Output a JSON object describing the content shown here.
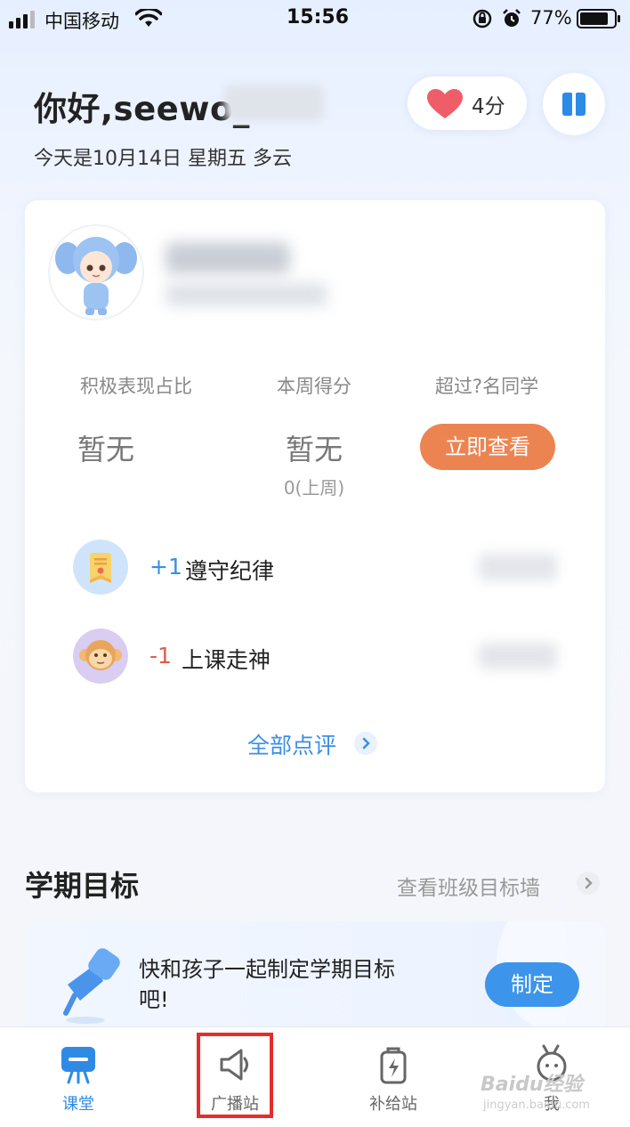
{
  "status_bar": {
    "carrier": "中国移动",
    "time": "15:56",
    "battery": "77%"
  },
  "header": {
    "greeting": "你好,seewo_",
    "date_line": "今天是10月14日 星期五 多云",
    "score": "4分"
  },
  "performance": {
    "stats": [
      {
        "label": "积极表现占比",
        "value": "暂无"
      },
      {
        "label": "本周得分",
        "value": "暂无",
        "sub": "0(上周)"
      },
      {
        "label": "超过?名同学",
        "button": "立即查看"
      }
    ],
    "records": [
      {
        "points": "+1",
        "text": "遵守纪律",
        "icon": "badge-icon"
      },
      {
        "points": "-1",
        "text": "上课走神",
        "icon": "monkey-icon"
      }
    ],
    "all_reviews": "全部点评"
  },
  "goals": {
    "title": "学期目标",
    "link": "查看班级目标墙",
    "prompt": "快和孩子一起制定学期目标吧!",
    "button": "制定"
  },
  "tabs": [
    {
      "label": "课堂",
      "icon": "classroom-icon",
      "active": true
    },
    {
      "label": "广播站",
      "icon": "broadcast-icon",
      "active": false
    },
    {
      "label": "补给站",
      "icon": "supply-icon",
      "active": false
    },
    {
      "label": "我",
      "icon": "profile-icon",
      "active": false
    }
  ],
  "watermark": {
    "brand": "Baidu经验",
    "url": "jingyan.baidu.com"
  },
  "colors": {
    "accent": "#3c8ee6",
    "orange": "#ec8452",
    "positive": "#3c8ee6",
    "negative": "#e05b4b",
    "highlight": "#e82b2b"
  }
}
